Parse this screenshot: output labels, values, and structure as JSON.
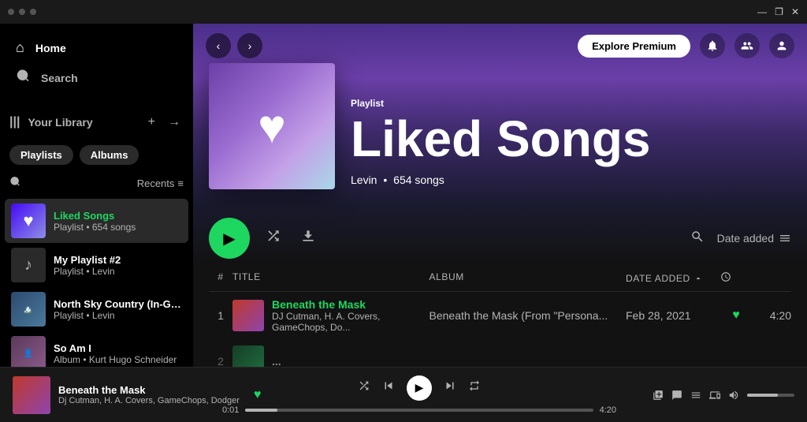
{
  "titlebar": {
    "controls": [
      "—",
      "❐",
      "✕"
    ]
  },
  "sidebar": {
    "nav": [
      {
        "id": "home",
        "icon": "⌂",
        "label": "Home"
      },
      {
        "id": "search",
        "icon": "🔍",
        "label": "Search"
      }
    ],
    "library": {
      "icon": "|||",
      "label": "Your Library",
      "add_label": "+",
      "expand_label": "→"
    },
    "filters": [
      "Playlists",
      "Albums"
    ],
    "search_icon": "🔍",
    "recents_label": "Recents",
    "playlists": [
      {
        "id": "liked-songs",
        "name": "Liked Songs",
        "name_green": true,
        "meta": "Playlist • 654 songs",
        "thumb_type": "heart",
        "active": true
      },
      {
        "id": "my-playlist-2",
        "name": "My Playlist #2",
        "meta": "Playlist • Levin",
        "thumb_type": "note",
        "active": false
      },
      {
        "id": "north-sky",
        "name": "North Sky Country (In-Game)",
        "meta": "Playlist • Levin",
        "thumb_type": "image1",
        "active": false
      },
      {
        "id": "so-am-i",
        "name": "So Am I",
        "meta": "Album • Kurt Hugo Schneider",
        "thumb_type": "image2",
        "active": false
      }
    ]
  },
  "content": {
    "topbar": {
      "back_label": "‹",
      "forward_label": "›",
      "explore_premium": "Explore Premium"
    },
    "hero": {
      "type_label": "Playlist",
      "title": "Liked Songs",
      "meta_user": "Levin",
      "meta_dot": "•",
      "meta_count": "654 songs"
    },
    "controls": {
      "date_added_label": "Date added"
    },
    "table_headers": {
      "num": "#",
      "title": "Title",
      "album": "Album",
      "date_added": "Date added",
      "duration_icon": "🕐"
    },
    "tracks": [
      {
        "num": "1",
        "name": "Beneath the Mask",
        "artist": "DJ Cutman, H. A. Covers, GameChops, Do...",
        "album": "Beneath the Mask (From \"Persona...",
        "date_added": "Feb 28, 2021",
        "liked": true,
        "duration": "4:20"
      },
      {
        "num": "2",
        "name": "",
        "artist": "",
        "album": "",
        "date_added": "",
        "liked": false,
        "duration": ""
      }
    ]
  },
  "player": {
    "track_name": "Beneath the Mask",
    "track_artist": "Dj Cutman, H. A. Covers, GameChops, Dodger",
    "current_time": "0:01",
    "total_time": "4:20",
    "progress_percent": 0.4
  }
}
